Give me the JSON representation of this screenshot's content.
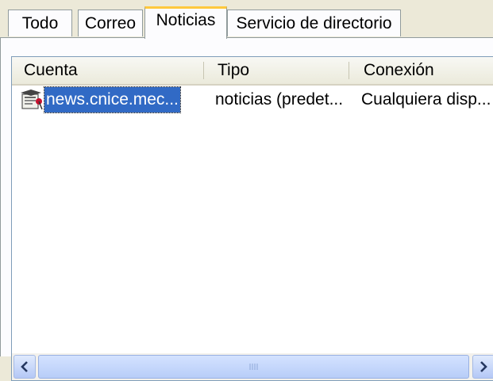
{
  "tabs": [
    {
      "label": "Todo"
    },
    {
      "label": "Correo"
    },
    {
      "label": "Noticias",
      "active": true
    },
    {
      "label": "Servicio de directorio"
    }
  ],
  "list": {
    "columns": [
      {
        "label": "Cuenta"
      },
      {
        "label": "Tipo"
      },
      {
        "label": "Conexión"
      }
    ],
    "rows": [
      {
        "icon": "news-server-icon",
        "account": "news.cnice.mec...",
        "type": "noticias (predet...",
        "connection": "Cualquiera disp...",
        "selected": true
      }
    ]
  },
  "colors": {
    "selection": "#316ac5",
    "active_tab_accent": "#ffc83c",
    "scrollbar": "#b8cdf8"
  }
}
